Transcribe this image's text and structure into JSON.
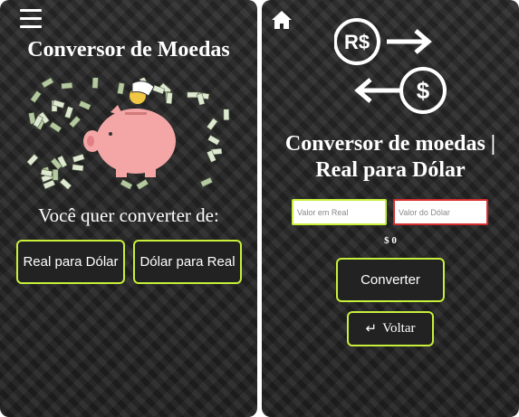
{
  "left": {
    "menu_icon": "hamburger-menu-icon",
    "title": "Conversor de Moedas",
    "hero_image": "piggy-bank-with-flying-money",
    "question": "Você quer converter de:",
    "buttons": {
      "real_to_dollar": "Real para Dólar",
      "dollar_to_real": "Dólar para Real"
    }
  },
  "right": {
    "home_icon": "home-icon",
    "hero_icon": "currency-exchange-icon",
    "hero_symbols": {
      "from": "R$",
      "to": "$"
    },
    "title_line1": "Conversor de moedas |",
    "title_line2": "Real para Dólar",
    "inputs": {
      "real_placeholder": "Valor em Real",
      "dollar_placeholder": "Valor do Dólar"
    },
    "result": "$ 0",
    "convert_button": "Converter",
    "back_button": "Voltar"
  },
  "colors": {
    "accent": "#c8ef3a",
    "error": "#d62e2e",
    "piggy": "#f4a6a6",
    "money": "#b5c9a0"
  }
}
